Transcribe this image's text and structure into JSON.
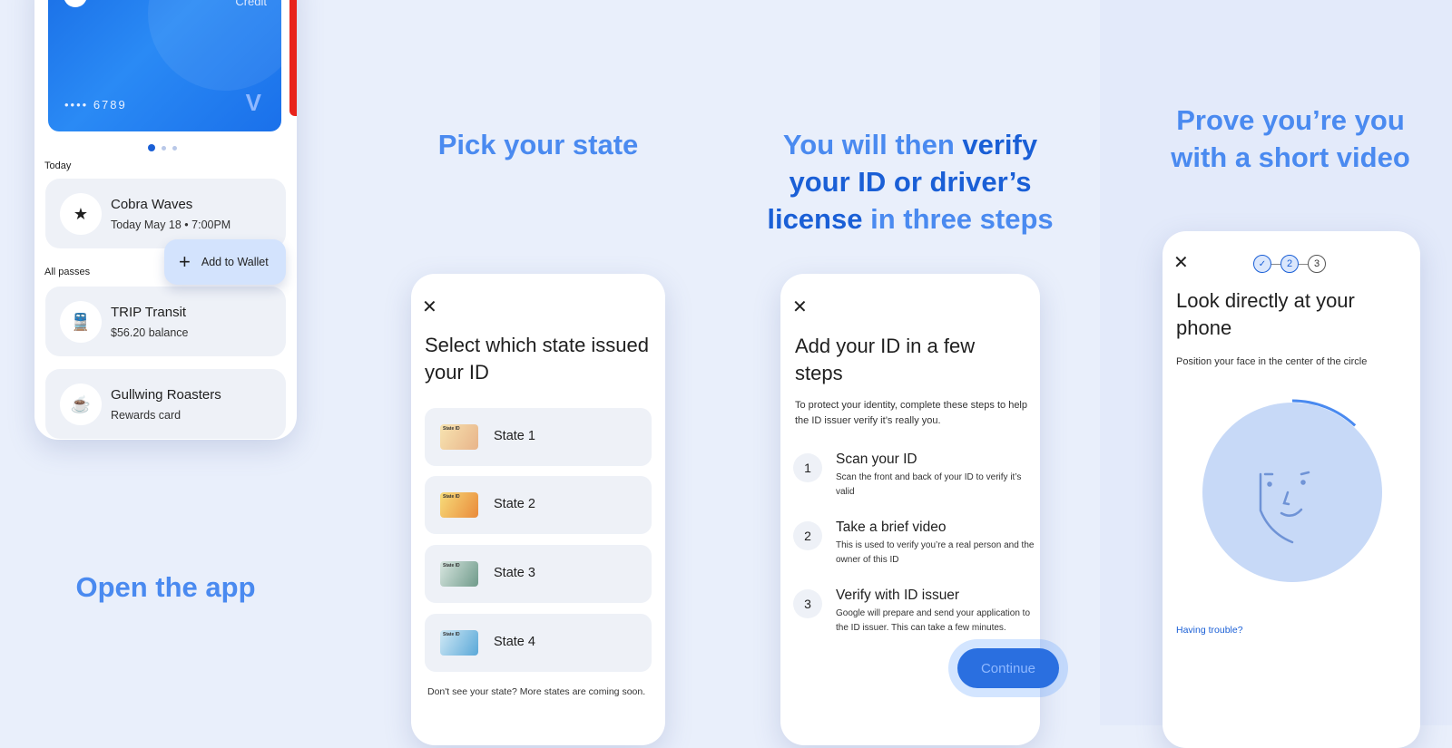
{
  "panel1": {
    "headline": "Open the app",
    "card": {
      "label": "Credit",
      "number": "•••• 6789"
    },
    "section_today": "Today",
    "section_all": "All passes",
    "passes": [
      {
        "title": "Cobra Waves",
        "subtitle": "Today May 18 • 7:00PM",
        "icon": "ticket-star-icon"
      },
      {
        "title": "TRIP Transit",
        "subtitle": "$56.20 balance",
        "icon": "train-icon"
      },
      {
        "title": "Gullwing Roasters",
        "subtitle": "Rewards card",
        "icon": "coffee-cup-icon"
      }
    ],
    "add_button": "Add to Wallet"
  },
  "panel2": {
    "headline": "Pick your state",
    "title": "Select which state issued your ID",
    "states": [
      {
        "label": "State 1",
        "thumb": "State ID"
      },
      {
        "label": "State 2",
        "thumb": "State ID"
      },
      {
        "label": "State 3",
        "thumb": "State ID"
      },
      {
        "label": "State 4",
        "thumb": "State ID"
      }
    ],
    "footer": "Don't see your state? More states are coming soon."
  },
  "panel3": {
    "headline_a": "You will then ",
    "headline_b": "verify your ID or driver’s license",
    "headline_c": " in three steps",
    "title": "Add your ID in a few steps",
    "intro": "To protect your identity, complete these steps to help the ID issuer verify it’s really you.",
    "steps": [
      {
        "num": "1",
        "title": "Scan your ID",
        "desc": "Scan the front and back of your ID to verify it’s valid"
      },
      {
        "num": "2",
        "title": "Take a brief video",
        "desc": "This is used to verify you’re a real person and the owner of this ID"
      },
      {
        "num": "3",
        "title": "Verify with ID issuer",
        "desc": "Google will prepare and send your application to the ID issuer. This can take a few minutes."
      }
    ],
    "continue": "Continue"
  },
  "panel4": {
    "headline": "Prove you’re you with a short video",
    "progress": {
      "steps": [
        "✓",
        "2",
        "3"
      ],
      "current": 2
    },
    "title": "Look directly at your phone",
    "instruction": "Position your face in the center of the circle",
    "help_link": "Having trouble?",
    "capture_progress": 0.12
  },
  "colors": {
    "accent": "#4a8af0",
    "dark_accent": "#1a5fd6",
    "card_blue": "#1a73e8"
  }
}
